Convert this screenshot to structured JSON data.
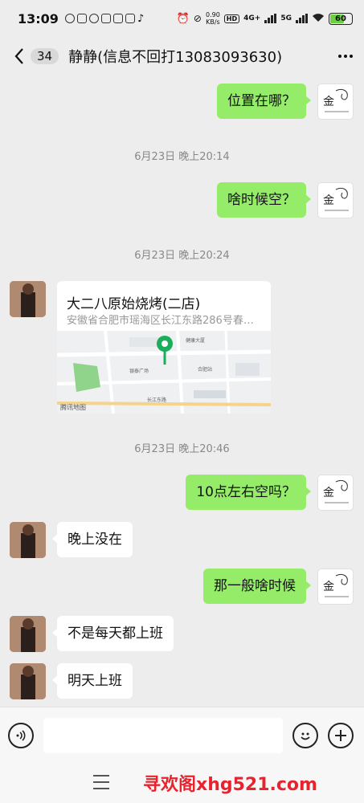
{
  "status_bar": {
    "time": "13:09",
    "net_speed_value": "0.90",
    "net_speed_unit": "KB/s",
    "hd": "HD",
    "network": "4G+",
    "network2": "5G",
    "battery": "60"
  },
  "header": {
    "unread_count": "34",
    "title": "静静(信息不回打13083093630)"
  },
  "messages": [
    {
      "type": "text",
      "from": "me",
      "text": "位置在哪？"
    },
    {
      "type": "time",
      "text": "6月23日 晚上20:14"
    },
    {
      "type": "text",
      "from": "me",
      "text": "啥时候空？"
    },
    {
      "type": "time",
      "text": "6月23日 晚上20:24"
    },
    {
      "type": "location",
      "from": "other",
      "name": "大二八原始烧烤(二店)",
      "address": "安徽省合肥市瑶海区长江东路286号春…",
      "map_credit": "腾讯地图"
    },
    {
      "type": "time",
      "text": "6月23日 晚上20:46"
    },
    {
      "type": "text",
      "from": "me",
      "text": "10点左右空吗？"
    },
    {
      "type": "text",
      "from": "other",
      "text": "晚上没在"
    },
    {
      "type": "text",
      "from": "me",
      "text": "那一般啥时候"
    },
    {
      "type": "text",
      "from": "other",
      "text": "不是每天都上班"
    },
    {
      "type": "text",
      "from": "other",
      "text": "明天上班"
    }
  ],
  "map_labels": [
    "健康大厦",
    "银泰广场",
    "合肥站",
    "长江东路"
  ],
  "colors": {
    "me_bubble": "#95ec69",
    "other_bubble": "#ffffff",
    "background": "#ededed",
    "map_pin": "#1aad5b",
    "watermark": "#e8232d"
  },
  "icons": {
    "back": "chevron-left-icon",
    "more": "more-dots-icon",
    "voice": "voice-icon",
    "emoji": "emoji-icon",
    "add": "plus-icon",
    "menu": "menu-icon",
    "pin": "map-pin-icon"
  },
  "watermark": "寻欢阁xhg521.com"
}
